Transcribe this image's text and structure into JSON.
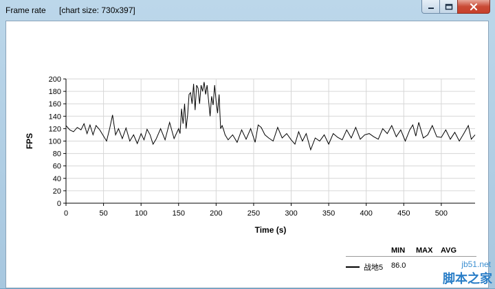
{
  "window": {
    "title": "Frame rate",
    "chart_size_label": "[chart size: 730x397]",
    "minimize_icon": "minimize-icon",
    "maximize_icon": "maximize-icon",
    "close_icon": "close-icon"
  },
  "legend": {
    "headers": [
      "MIN",
      "MAX",
      "AVG"
    ],
    "series_name": "战地5",
    "min_value": "86.0"
  },
  "watermark": {
    "url": "jb51.net",
    "site": "脚本之家"
  },
  "chart_data": {
    "type": "line",
    "xlabel": "Time (s)",
    "ylabel": "FPS",
    "xlim": [
      0,
      545
    ],
    "ylim": [
      0,
      200
    ],
    "x_ticks": [
      0,
      50,
      100,
      150,
      200,
      250,
      300,
      350,
      400,
      450,
      500
    ],
    "y_ticks": [
      0,
      20,
      40,
      60,
      80,
      100,
      120,
      140,
      160,
      180,
      200
    ],
    "grid": true,
    "series": [
      {
        "name": "战地5",
        "color": "#000000",
        "x": [
          0,
          5,
          10,
          15,
          20,
          24,
          28,
          32,
          36,
          40,
          45,
          50,
          54,
          58,
          62,
          66,
          70,
          75,
          80,
          85,
          90,
          95,
          100,
          104,
          108,
          112,
          116,
          120,
          126,
          132,
          138,
          144,
          150,
          152,
          154,
          156,
          158,
          160,
          162,
          164,
          166,
          168,
          170,
          172,
          174,
          176,
          178,
          180,
          182,
          184,
          186,
          188,
          190,
          192,
          194,
          196,
          198,
          200,
          202,
          204,
          206,
          208,
          210,
          212,
          216,
          222,
          228,
          234,
          240,
          246,
          252,
          256,
          260,
          265,
          270,
          276,
          282,
          288,
          294,
          300,
          305,
          310,
          315,
          320,
          326,
          332,
          338,
          344,
          350,
          356,
          362,
          368,
          374,
          380,
          386,
          392,
          398,
          404,
          410,
          416,
          422,
          428,
          434,
          440,
          446,
          452,
          458,
          462,
          466,
          470,
          476,
          482,
          488,
          494,
          500,
          506,
          512,
          518,
          524,
          530,
          536,
          540,
          545
        ],
        "y": [
          125,
          118,
          115,
          122,
          118,
          128,
          112,
          126,
          110,
          125,
          118,
          108,
          100,
          119,
          142,
          110,
          120,
          104,
          121,
          100,
          110,
          96,
          112,
          102,
          119,
          110,
          95,
          103,
          120,
          102,
          130,
          104,
          120,
          112,
          152,
          128,
          160,
          120,
          142,
          175,
          178,
          160,
          192,
          150,
          190,
          185,
          160,
          190,
          180,
          195,
          175,
          190,
          165,
          140,
          172,
          158,
          190,
          165,
          145,
          175,
          120,
          125,
          118,
          110,
          102,
          110,
          98,
          118,
          103,
          120,
          98,
          126,
          122,
          110,
          105,
          100,
          122,
          105,
          112,
          102,
          95,
          115,
          100,
          112,
          86,
          105,
          100,
          110,
          95,
          112,
          106,
          102,
          118,
          105,
          122,
          103,
          110,
          112,
          107,
          103,
          120,
          112,
          125,
          107,
          118,
          100,
          118,
          126,
          108,
          130,
          105,
          110,
          125,
          107,
          106,
          118,
          103,
          114,
          100,
          112,
          125,
          103,
          110
        ]
      }
    ]
  }
}
